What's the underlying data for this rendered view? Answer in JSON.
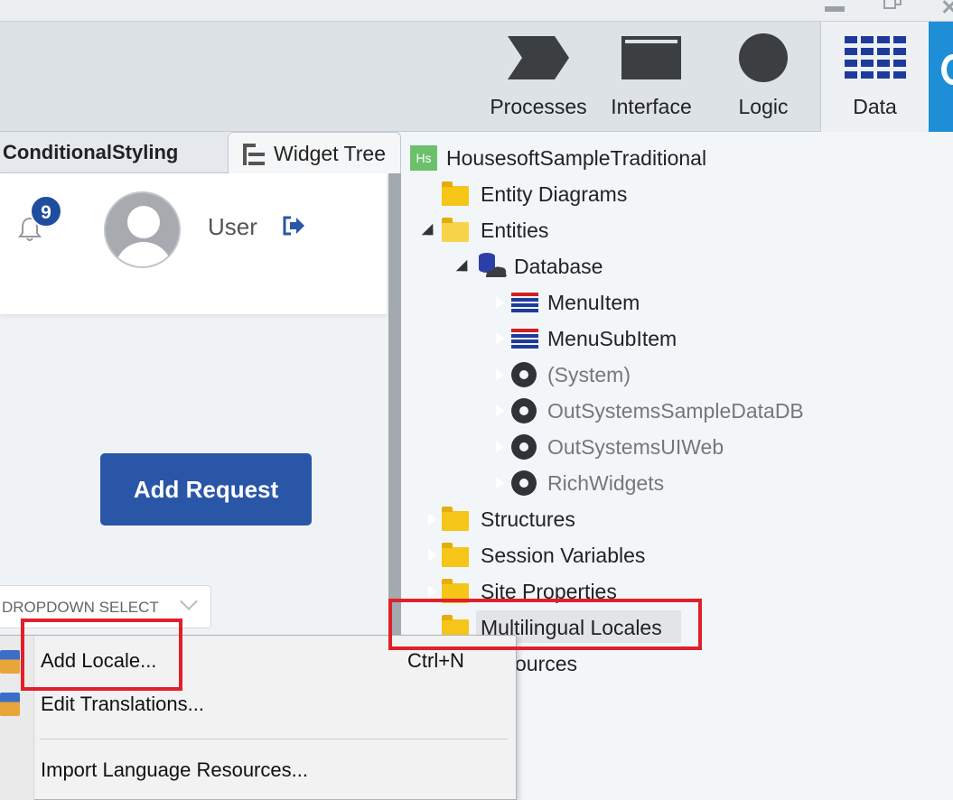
{
  "toolbar": {
    "processes": "Processes",
    "interface": "Interface",
    "logic": "Logic",
    "data": "Data"
  },
  "left_tabs": {
    "screen_tab": "ConditionalStyling",
    "widget_tree_tab": "Widget Tree"
  },
  "canvas": {
    "notification_count": "9",
    "user_name": "User",
    "add_request_label": "Add Request",
    "dropdown_text": "DROPDOWN SELECT"
  },
  "tree": {
    "root": "HousesoftSampleTraditional",
    "root_icon_text": "Hs",
    "entity_diagrams": "Entity Diagrams",
    "entities": "Entities",
    "database": "Database",
    "menu_item": "MenuItem",
    "menu_sub_item": "MenuSubItem",
    "system": "(System)",
    "sample_data_db": "OutSystemsSampleDataDB",
    "ui_web": "OutSystemsUIWeb",
    "rich_widgets": "RichWidgets",
    "structures": "Structures",
    "session_variables": "Session Variables",
    "site_properties": "Site Properties",
    "multilingual_locales": "Multilingual Locales",
    "resources_partial": "ources"
  },
  "context_menu": {
    "add_locale": "Add Locale...",
    "add_locale_shortcut": "Ctrl+N",
    "edit_translations": "Edit Translations...",
    "import_language_resources": "Import Language Resources..."
  },
  "colors": {
    "accent_blue": "#2a56a8",
    "annotation_red": "#e0202a",
    "data_tab_blue": "#1e3b9c"
  }
}
